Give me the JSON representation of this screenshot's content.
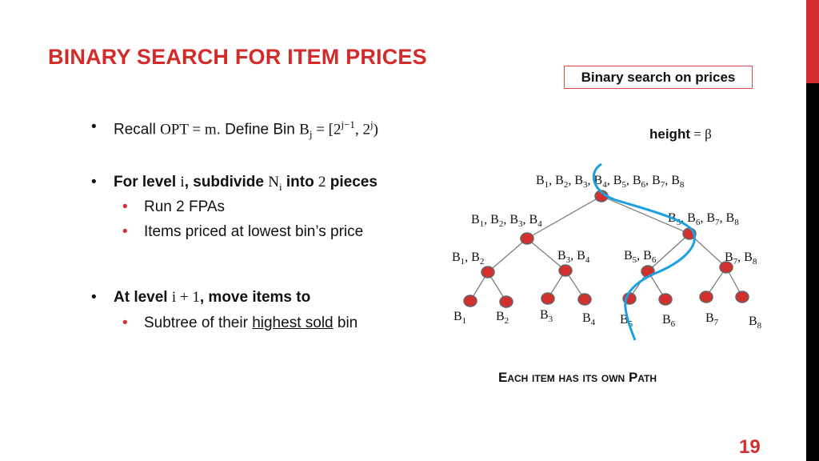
{
  "title": "BINARY SEARCH FOR ITEM PRICES",
  "box_label": "Binary search on prices",
  "height_label": {
    "word": "height",
    "expr": " = β"
  },
  "bullets": [
    {
      "parts": [
        "Recall ",
        "OPT = m",
        ". Define Bin ",
        "B",
        "j",
        " = [2",
        "j−1",
        ", 2",
        "j",
        ")"
      ]
    },
    {
      "parts": [
        "For level ",
        "i",
        ",  subdivide ",
        "N",
        "i",
        " into ",
        "2",
        " pieces"
      ],
      "subs": [
        "Run 2 FPAs",
        "Items priced at lowest bin’s price"
      ]
    },
    {
      "parts": [
        "At level ",
        "i + 1",
        ", move items to"
      ],
      "subs": [
        {
          "pre": "Subtree of their ",
          "underlined": "highest sold",
          "post": " bin"
        }
      ]
    }
  ],
  "tree": {
    "levels": [
      [
        [
          "1",
          "2",
          "3",
          "4",
          "5",
          "6",
          "7",
          "8"
        ]
      ],
      [
        [
          "1",
          "2",
          "3",
          "4"
        ],
        [
          "5",
          "6",
          "7",
          "8"
        ]
      ],
      [
        [
          "1",
          "2"
        ],
        [
          "3",
          "4"
        ],
        [
          "5",
          "6"
        ],
        [
          "7",
          "8"
        ]
      ],
      [
        [
          "1"
        ],
        [
          "2"
        ],
        [
          "3"
        ],
        [
          "4"
        ],
        [
          "5"
        ],
        [
          "6"
        ],
        [
          "7"
        ],
        [
          "8"
        ]
      ]
    ],
    "node_color": "#d32f2f",
    "path_color": "#1ba1e2"
  },
  "caption": "Each item has its own Path",
  "page_number": "19",
  "colors": {
    "accent": "#d32f2f",
    "text": "#111111",
    "path": "#1ba1e2"
  }
}
